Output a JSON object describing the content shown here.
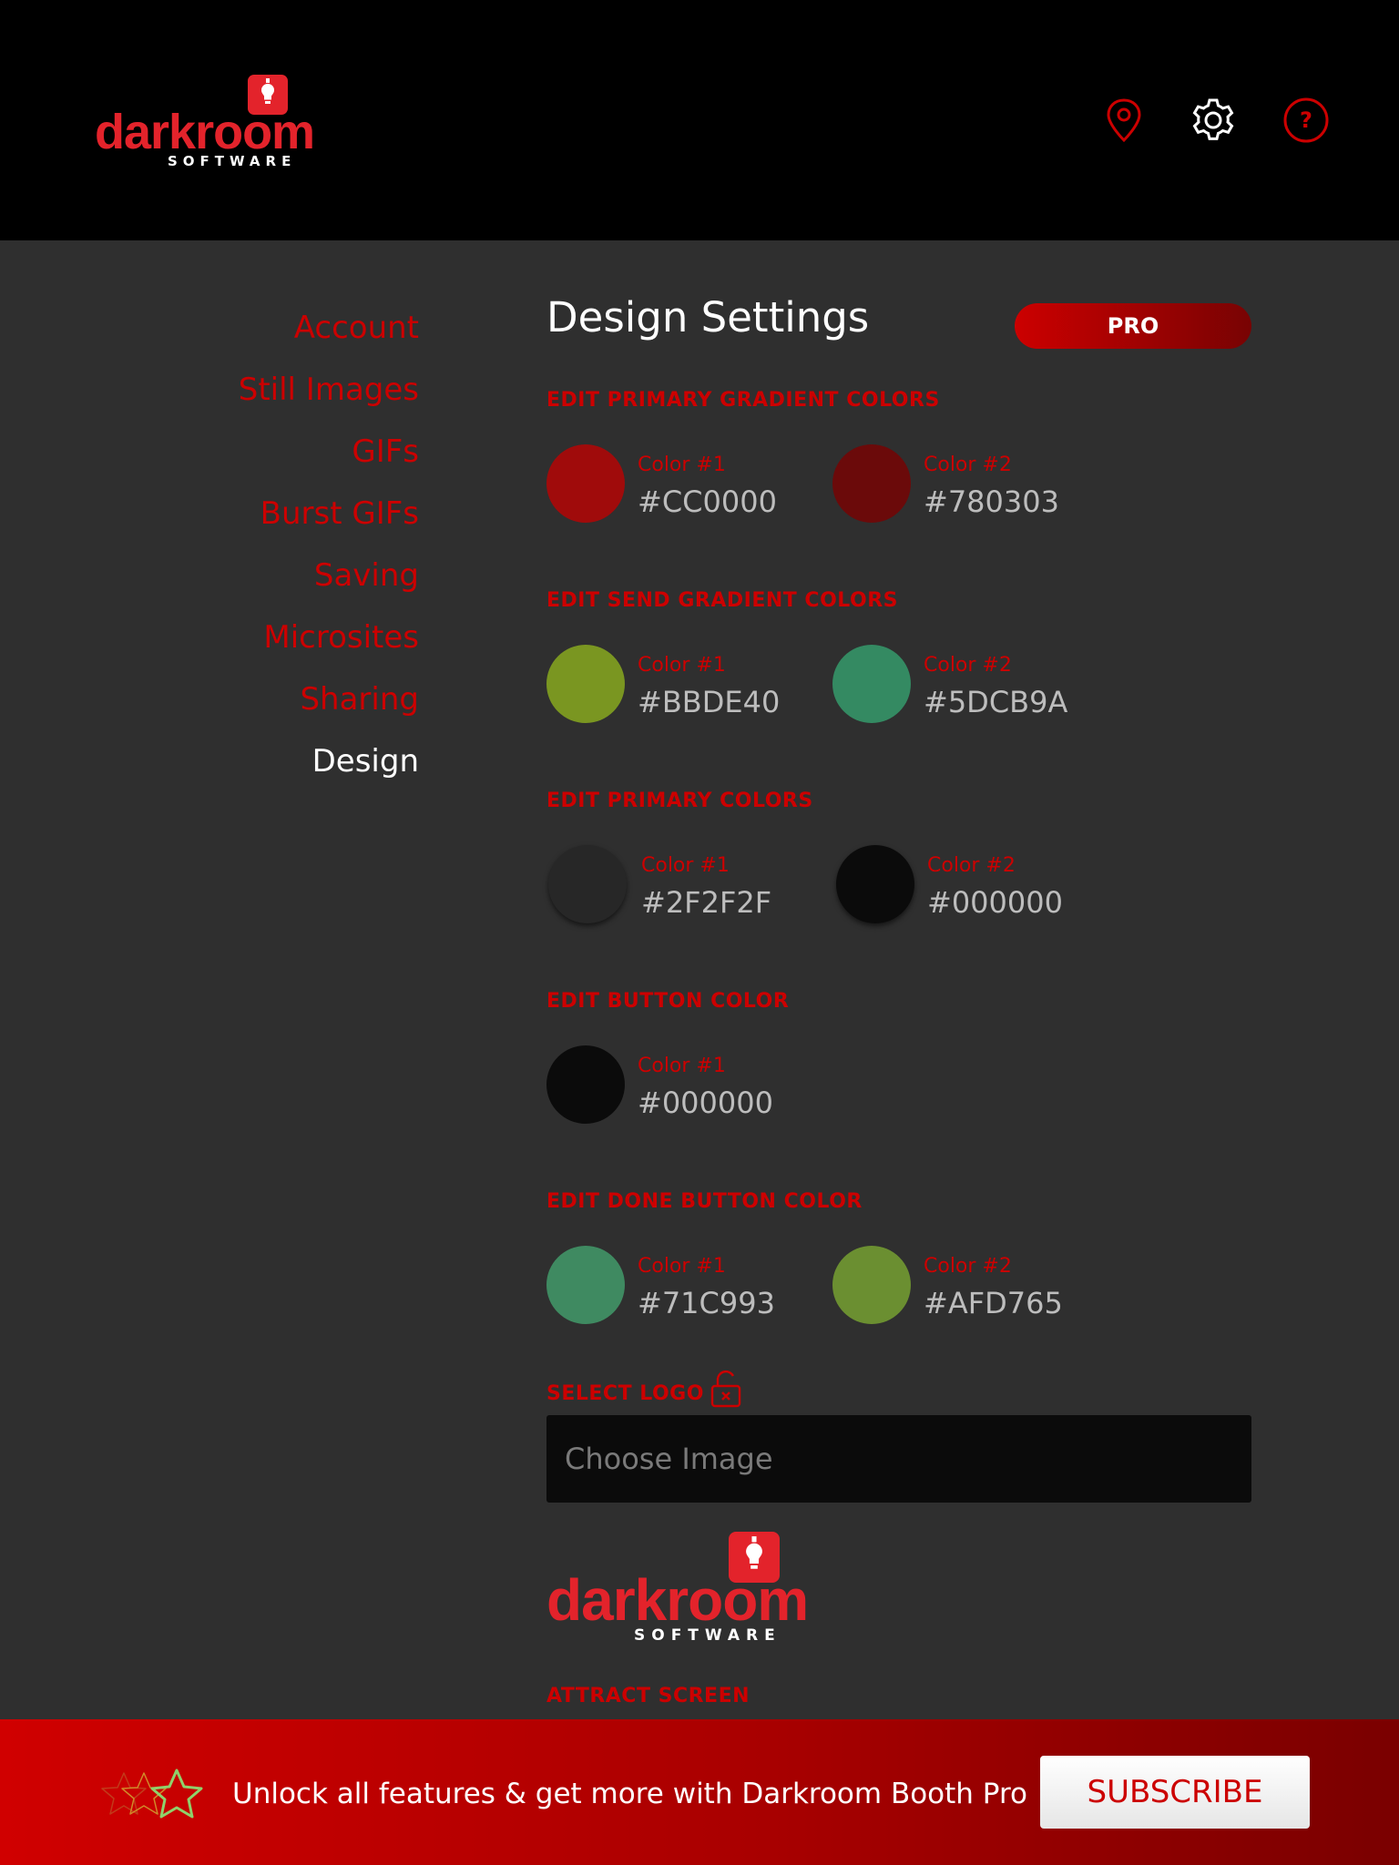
{
  "header": {
    "logo_word": "darkroom",
    "logo_sub": "SOFTWARE",
    "icons": [
      "location-pin-icon",
      "gear-icon",
      "help-icon"
    ]
  },
  "sidebar": {
    "items": [
      {
        "label": "Account"
      },
      {
        "label": "Still Images"
      },
      {
        "label": "GIFs"
      },
      {
        "label": "Burst GIFs"
      },
      {
        "label": "Saving"
      },
      {
        "label": "Microsites"
      },
      {
        "label": "Sharing"
      },
      {
        "label": "Design",
        "active": true
      }
    ]
  },
  "main": {
    "title": "Design Settings",
    "pro_badge": "PRO",
    "sections": [
      {
        "label": "EDIT PRIMARY GRADIENT COLORS",
        "colors": [
          {
            "label": "Color #1",
            "value": "#CC0000",
            "swatch": "#a00b0b"
          },
          {
            "label": "Color #2",
            "value": "#780303",
            "swatch": "#6b0a0a"
          }
        ]
      },
      {
        "label": "EDIT SEND GRADIENT COLORS",
        "colors": [
          {
            "label": "Color #1",
            "value": "#BBDE40",
            "swatch": "#7a9621"
          },
          {
            "label": "Color #2",
            "value": "#5DCB9A",
            "swatch": "#348a62"
          }
        ]
      },
      {
        "label": "EDIT PRIMARY COLORS",
        "colors": [
          {
            "label": "Color #1",
            "value": "#2F2F2F",
            "swatch": "#272727"
          },
          {
            "label": "Color #2",
            "value": "#000000",
            "swatch": "#0b0b0b"
          }
        ]
      },
      {
        "label": "EDIT BUTTON COLOR",
        "colors": [
          {
            "label": "Color #1",
            "value": "#000000",
            "swatch": "#0b0b0b"
          }
        ]
      },
      {
        "label": "EDIT DONE BUTTON COLOR",
        "colors": [
          {
            "label": "Color #1",
            "value": "#71C993",
            "swatch": "#3f8a61"
          },
          {
            "label": "Color #2",
            "value": "#AFD765",
            "swatch": "#6b8f31"
          }
        ]
      }
    ],
    "select_logo_label": "SELECT LOGO",
    "choose_image_placeholder": "Choose Image",
    "attract_screen_label": "ATTRACT SCREEN"
  },
  "footer": {
    "text": "Unlock all features & get more with Darkroom Booth Pro",
    "subscribe_label": "SUBSCRIBE"
  },
  "colors": {
    "accent": "#cc0000",
    "background": "#2f2f2f",
    "header_background": "#000000"
  }
}
